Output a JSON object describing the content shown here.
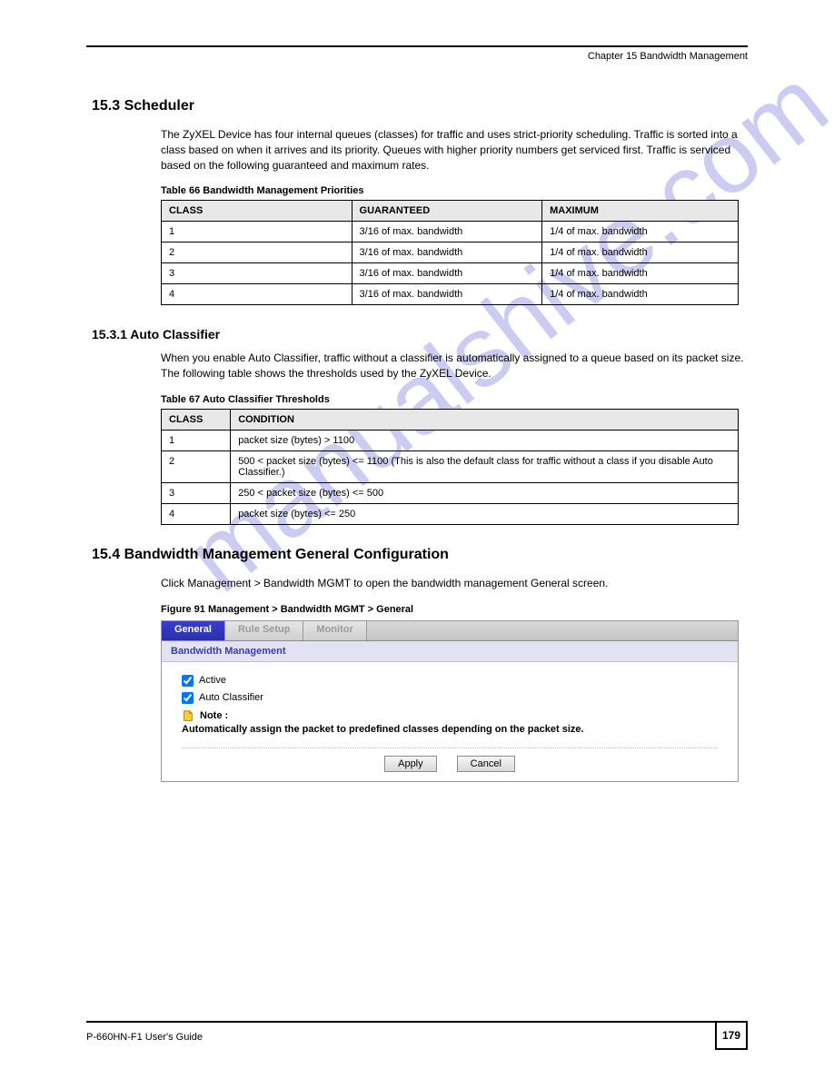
{
  "chapter_header": "Chapter 15 Bandwidth Management",
  "section1": {
    "number": "15.3  Scheduler",
    "intro": "The ZyXEL Device has four internal queues (classes) for traffic and uses strict-priority scheduling. Traffic is sorted into a class based on when it arrives and its priority. Queues with higher priority numbers get serviced first. Traffic is serviced based on the following guaranteed and maximum rates.",
    "table_caption": "Table 66   Bandwidth Management Priorities",
    "table_headers": [
      "CLASS",
      "GUARANTEED",
      "MAXIMUM"
    ],
    "table_rows": [
      [
        "1",
        "3/16 of max. bandwidth",
        "1/4 of max. bandwidth"
      ],
      [
        "2",
        "3/16 of max. bandwidth",
        "1/4 of max. bandwidth"
      ],
      [
        "3",
        "3/16 of max. bandwidth",
        "1/4 of max. bandwidth"
      ],
      [
        "4",
        "3/16 of max. bandwidth",
        "1/4 of max. bandwidth"
      ]
    ],
    "sub_number": "15.3.1  Auto Classifier",
    "sub_text": "When you enable Auto Classifier, traffic without a classifier is automatically assigned to a queue based on its packet size. The following table shows the thresholds used by the ZyXEL Device.",
    "table2_caption": "Table 67   Auto Classifier Thresholds",
    "table2_headers": [
      "CLASS",
      "CONDITION"
    ],
    "table2_rows": [
      [
        "1",
        "packet size (bytes) > 1100"
      ],
      [
        "2",
        "500 < packet size (bytes) <= 1100 (This is also the default class for traffic without a class if you disable Auto Classifier.)"
      ],
      [
        "3",
        "250 < packet size (bytes) <= 500"
      ],
      [
        "4",
        "packet size (bytes) <= 250"
      ]
    ]
  },
  "section2": {
    "number": "15.4  Bandwidth Management General Configuration",
    "intro": "Click Management > Bandwidth MGMT to open the bandwidth management General screen.",
    "figure_caption": "Figure 91   Management > Bandwidth MGMT > General"
  },
  "screenshot": {
    "tabs": [
      "General",
      "Rule Setup",
      "Monitor"
    ],
    "panel_title": "Bandwidth Management",
    "cb_active": "Active",
    "cb_auto": "Auto Classifier",
    "note_label": "Note :",
    "note_body": "Automatically assign the packet to predefined classes depending on the packet size.",
    "btn_apply": "Apply",
    "btn_cancel": "Cancel"
  },
  "footer": {
    "left": "P-660HN-F1 User's Guide",
    "page": "179"
  },
  "watermark": "manualshive.com"
}
